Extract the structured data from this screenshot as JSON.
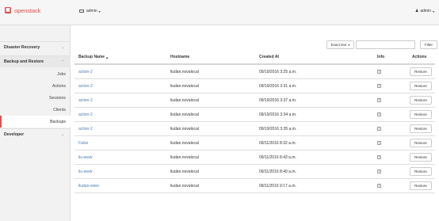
{
  "header": {
    "logo_text": "openstack",
    "project": "admin",
    "user": "admin"
  },
  "sidebar": {
    "sections": [
      {
        "label": "Disaster Recovery"
      },
      {
        "label": "Backup and Restore"
      },
      {
        "label": "Developer"
      }
    ],
    "items": [
      {
        "label": "Jobs"
      },
      {
        "label": "Actions"
      },
      {
        "label": "Sessions"
      },
      {
        "label": "Clients"
      },
      {
        "label": "Backups"
      }
    ]
  },
  "toolbar": {
    "filter_select": "Exact text",
    "filter_placeholder": "",
    "filter_button": "Filter"
  },
  "table": {
    "columns": {
      "name": "Backup Name",
      "hostname": "Hostname",
      "created": "Created At",
      "info": "Info",
      "actions": "Actions"
    },
    "restore_label": "Restore",
    "info_glyph": "i",
    "rows": [
      {
        "name": "action-2",
        "hostname": "liudan.novalocal",
        "created": "09/19/2016 3:25 a.m."
      },
      {
        "name": "action-2",
        "hostname": "liudan.novalocal",
        "created": "09/19/2016 3:31 a.m."
      },
      {
        "name": "action-2",
        "hostname": "liudan.novalocal",
        "created": "09/19/2016 3:37 a.m."
      },
      {
        "name": "action-2",
        "hostname": "liudan.novalocal",
        "created": "09/19/2016 3:34 a.m."
      },
      {
        "name": "action-2",
        "hostname": "liudan.novalocal",
        "created": "09/19/2016 3:35 a.m."
      },
      {
        "name": "False",
        "hostname": "liudan.novalocal",
        "created": "09/11/2016 8:32 a.m."
      },
      {
        "name": "liu-www",
        "hostname": "liudan.novalocal",
        "created": "09/11/2016 8:43 a.m."
      },
      {
        "name": "liu-www",
        "hostname": "liudan.novalocal",
        "created": "09/11/2016 8:49 a.m."
      },
      {
        "name": "liudan-www",
        "hostname": "liudan.novalocal",
        "created": "09/11/2016 9:17 a.m."
      }
    ]
  }
}
